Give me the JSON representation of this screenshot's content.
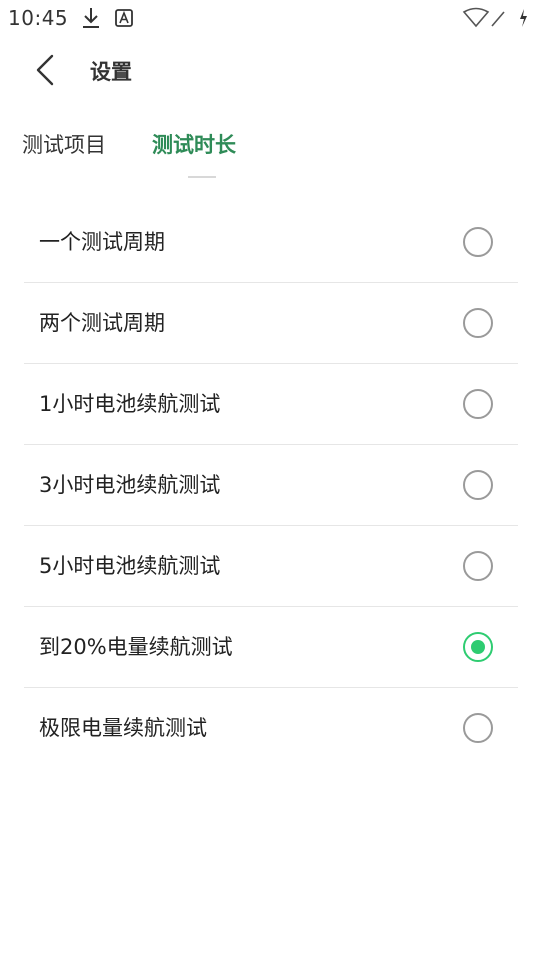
{
  "status_bar": {
    "time": "10:45",
    "icons": [
      "download-icon",
      "text-a-icon",
      "wifi-icon",
      "signal-icon",
      "charging-icon"
    ]
  },
  "header": {
    "back_icon": "chevron-left-icon",
    "title": "设置"
  },
  "tabs": {
    "items_label": "测试项目",
    "duration_label": "测试时长",
    "active": "测试时长",
    "active_color": "#2e8b57"
  },
  "options": [
    {
      "label": "一个测试周期",
      "selected": false
    },
    {
      "label": "两个测试周期",
      "selected": false
    },
    {
      "label": "1小时电池续航测试",
      "selected": false
    },
    {
      "label": "3小时电池续航测试",
      "selected": false
    },
    {
      "label": "5小时电池续航测试",
      "selected": false
    },
    {
      "label": "到20%电量续航测试",
      "selected": true
    },
    {
      "label": "极限电量续航测试",
      "selected": false
    }
  ],
  "colors": {
    "accent": "#2ecc71",
    "radio_border": "#9a9a9a",
    "divider": "#e6e6e6"
  }
}
